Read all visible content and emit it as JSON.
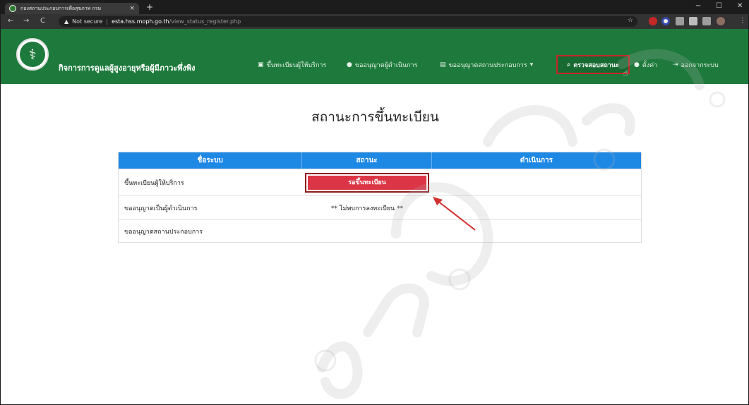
{
  "browser": {
    "tab_title": "กองสถานประกอบการเพื่อสุขภาพ กรม",
    "tab_close": "×",
    "new_tab": "+",
    "window_minimize": "−",
    "window_maximize": "☐",
    "window_close": "✕",
    "nav_back": "←",
    "nav_forward": "→",
    "nav_reload": "C",
    "security_label": "Not secure",
    "separator": "|",
    "url_host": "esta.hss.moph.go.th",
    "url_path": "/view_status_register.php"
  },
  "navbar": {
    "brand": "กิจการการดูแลผู้สูงอายุหรือผู้มีภาวะพึ่งพิง",
    "items": [
      {
        "label": "ขึ้นทะเบียนผู้ให้บริการ"
      },
      {
        "label": "ขออนุญาตผู้ดำเนินการ"
      },
      {
        "label": "ขออนุญาตสถานประกอบการ"
      }
    ],
    "active_item": "ตรวจสอบสถานะ",
    "settings": "ตั้งค่า",
    "logout": "ออกจากระบบ"
  },
  "page": {
    "title": "สถานะการขึ้นทะเบียน"
  },
  "table": {
    "headers": [
      "ชื่อระบบ",
      "สถานะ",
      "ดำเนินการ"
    ],
    "rows": [
      {
        "system": "ขึ้นทะเบียนผู้ให้บริการ",
        "status": "รอขึ้นทะเบียน",
        "action": ""
      },
      {
        "system": "ขออนุญาตเป็นผู้ดำเนินการ",
        "status": "** ไม่พบการลงทะเบียน **",
        "action": ""
      },
      {
        "system": "ขออนุญาตสถานประกอบการ",
        "status": "",
        "action": ""
      }
    ]
  },
  "colors": {
    "navbar": "#1d7a3c",
    "table_header": "#1e88e5",
    "status_button": "#dc3545",
    "highlight": "#c62828"
  }
}
